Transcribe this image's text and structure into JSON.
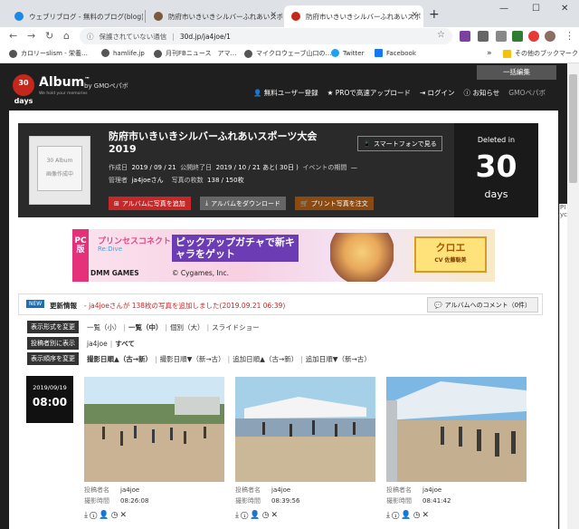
{
  "browser": {
    "tabs": [
      {
        "title": "ウェブリブログ - 無料のブログ(blog)サ",
        "favicon_color": "#1e88e5"
      },
      {
        "title": "防府市いきいきシルバーふれあいスポ",
        "favicon_color": "#7a5a3c"
      },
      {
        "title": "防府市いきいきシルバーふれあいスポ",
        "favicon_color": "#c4281c",
        "active": true
      }
    ],
    "new_tab": "+",
    "window_controls": [
      "—",
      "☐",
      "✕"
    ],
    "nav": {
      "back": "←",
      "forward": "→",
      "reload": "↻",
      "home": "⌂"
    },
    "security_text": "保護されていない通信",
    "url": "30d.jp/ja4joe/1",
    "bookmarks": [
      {
        "label": "カロリーslism - 栄養…",
        "color": "#555"
      },
      {
        "label": "hamlife.jp",
        "color": "#555"
      },
      {
        "label": "月刊FBニュース　アマ…",
        "color": "#555"
      },
      {
        "label": "マイクロウェーブ山口の…",
        "color": "#555"
      },
      {
        "label": "Twitter",
        "color": "#1da1f2"
      },
      {
        "label": "Facebook",
        "color": "#1877f2"
      }
    ],
    "bookmarks_more": "»",
    "other_bookmarks": "その他のブックマーク"
  },
  "site": {
    "logo_days": "30 days",
    "logo_name": "Album",
    "logo_tm": "™",
    "logo_tagline": "We hold your memories",
    "logo_by": "by GMOペパボ",
    "bulk_edit": "一括編集",
    "nav": {
      "register": "無料ユーザー登録",
      "pro": "PROで高速アップロード",
      "login": "ログイン",
      "notice": "お知らせ",
      "gmo": "GMOペパボ"
    }
  },
  "album": {
    "cover_label": "30 Album",
    "cover_sub": "画像作成中",
    "title": "防府市いきいきシルバーふれあいスポーツ大会2019",
    "smartphone_btn": "スマートフォンで見る",
    "created_label": "作成日",
    "created": "2019 / 09 / 21",
    "end_label": "公開終了日",
    "end": "2019 / 10 / 21 あと( 30日 )",
    "period_label": "イベントの期間",
    "period": "—",
    "admin_label": "管理者",
    "admin": "ja4joeさん",
    "count_label": "写真の枚数",
    "count": "138 / 150枚",
    "btn_add": "アルバムに写真を追加",
    "btn_download": "アルバムをダウンロード",
    "btn_print": "プリント写真を注文",
    "deleted_label": "Deleted in",
    "deleted_days": "30",
    "deleted_unit": "days"
  },
  "banner": {
    "pc": "PC版",
    "game": "プリンセスコネクト！",
    "game_sub": "Re:Dive",
    "headline": "ピックアップガチャで新キャラをゲット",
    "dmm": "DMM GAMES",
    "cygames": "© Cygames, Inc.",
    "char_name": "クロエ",
    "char_sub": "CV 佐藤聡美"
  },
  "news": {
    "tag": "NEW",
    "label": "更新情報",
    "message": "- ja4joeさんが 138枚の写真を追加しました(2019.09.21 06:39)",
    "comment_btn": "アルバムへのコメント（0件）"
  },
  "filters": {
    "display": {
      "label": "表示形式を変更",
      "options": [
        "一覧（小）",
        "一覧（中）",
        "個別（大）",
        "スライドショー"
      ],
      "selected": 1
    },
    "poster": {
      "label": "投稿者別に表示",
      "options": [
        "ja4joe",
        "すべて"
      ],
      "selected": 1
    },
    "order": {
      "label": "表示順序を変更",
      "options": [
        "撮影日順▲（古→新）",
        "撮影日順▼（新→古）",
        "追加日順▲（古→新）",
        "追加日順▼（新→古）"
      ],
      "selected": 0
    }
  },
  "date_group": {
    "date": "2019/09/19",
    "time": "08:00"
  },
  "photos": [
    {
      "poster_label": "投稿者名",
      "poster": "ja4joe",
      "time_label": "撮影時間",
      "time": "08:26:08"
    },
    {
      "poster_label": "投稿者名",
      "poster": "ja4joe",
      "time_label": "撮影時間",
      "time": "08:39:56"
    },
    {
      "poster_label": "投稿者名",
      "poster": "ja4joe",
      "time_label": "撮影時間",
      "time": "08:41:42"
    }
  ],
  "sidepeek": "PI yc"
}
